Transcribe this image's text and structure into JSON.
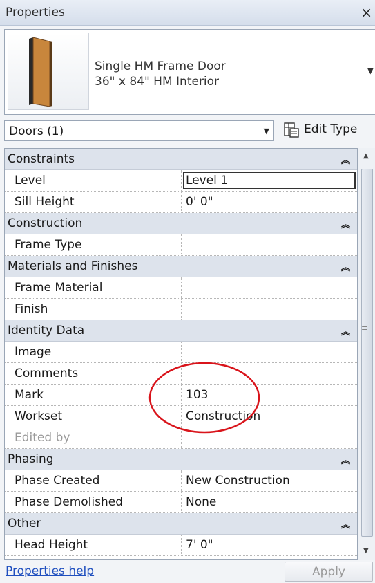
{
  "window": {
    "title": "Properties",
    "close_glyph": "×"
  },
  "type_selector": {
    "family": "Single HM Frame Door",
    "type": "36\" x 84\" HM Interior",
    "thumbnail_icon": "door-icon",
    "dropdown_glyph": "▼"
  },
  "filter": {
    "value": "Doors (1)",
    "dropdown_glyph": "▼",
    "edit_type_label": "Edit Type",
    "edit_type_icon": "edit-type-icon"
  },
  "groups": {
    "constraints": {
      "label": "Constraints",
      "collapse_glyph": "︽",
      "level": {
        "name": "Level",
        "value": "Level 1"
      },
      "sill_height": {
        "name": "Sill Height",
        "value": "0'  0\""
      }
    },
    "construction": {
      "label": "Construction",
      "collapse_glyph": "︽",
      "frame_type": {
        "name": "Frame Type",
        "value": ""
      }
    },
    "materials": {
      "label": "Materials and Finishes",
      "collapse_glyph": "︽",
      "frame_material": {
        "name": "Frame Material",
        "value": ""
      },
      "finish": {
        "name": "Finish",
        "value": ""
      }
    },
    "identity": {
      "label": "Identity Data",
      "collapse_glyph": "︽",
      "image": {
        "name": "Image",
        "value": ""
      },
      "comments": {
        "name": "Comments",
        "value": ""
      },
      "mark": {
        "name": "Mark",
        "value": "103"
      },
      "workset": {
        "name": "Workset",
        "value": "Construction"
      },
      "edited_by": {
        "name": "Edited by",
        "value": ""
      }
    },
    "phasing": {
      "label": "Phasing",
      "collapse_glyph": "︽",
      "phase_created": {
        "name": "Phase Created",
        "value": "New Construction"
      },
      "phase_demolished": {
        "name": "Phase Demolished",
        "value": "None"
      }
    },
    "other": {
      "label": "Other",
      "collapse_glyph": "︽",
      "head_height": {
        "name": "Head Height",
        "value": "7'  0\""
      }
    }
  },
  "scrollbar": {
    "up_glyph": "▲",
    "down_glyph": "▼",
    "grip_glyph": "≡"
  },
  "footer": {
    "help_link": "Properties help",
    "apply_label": "Apply"
  },
  "colors": {
    "annotation": "#d9141b",
    "door_panel": "#c8863c",
    "link": "#1f4fbf"
  }
}
